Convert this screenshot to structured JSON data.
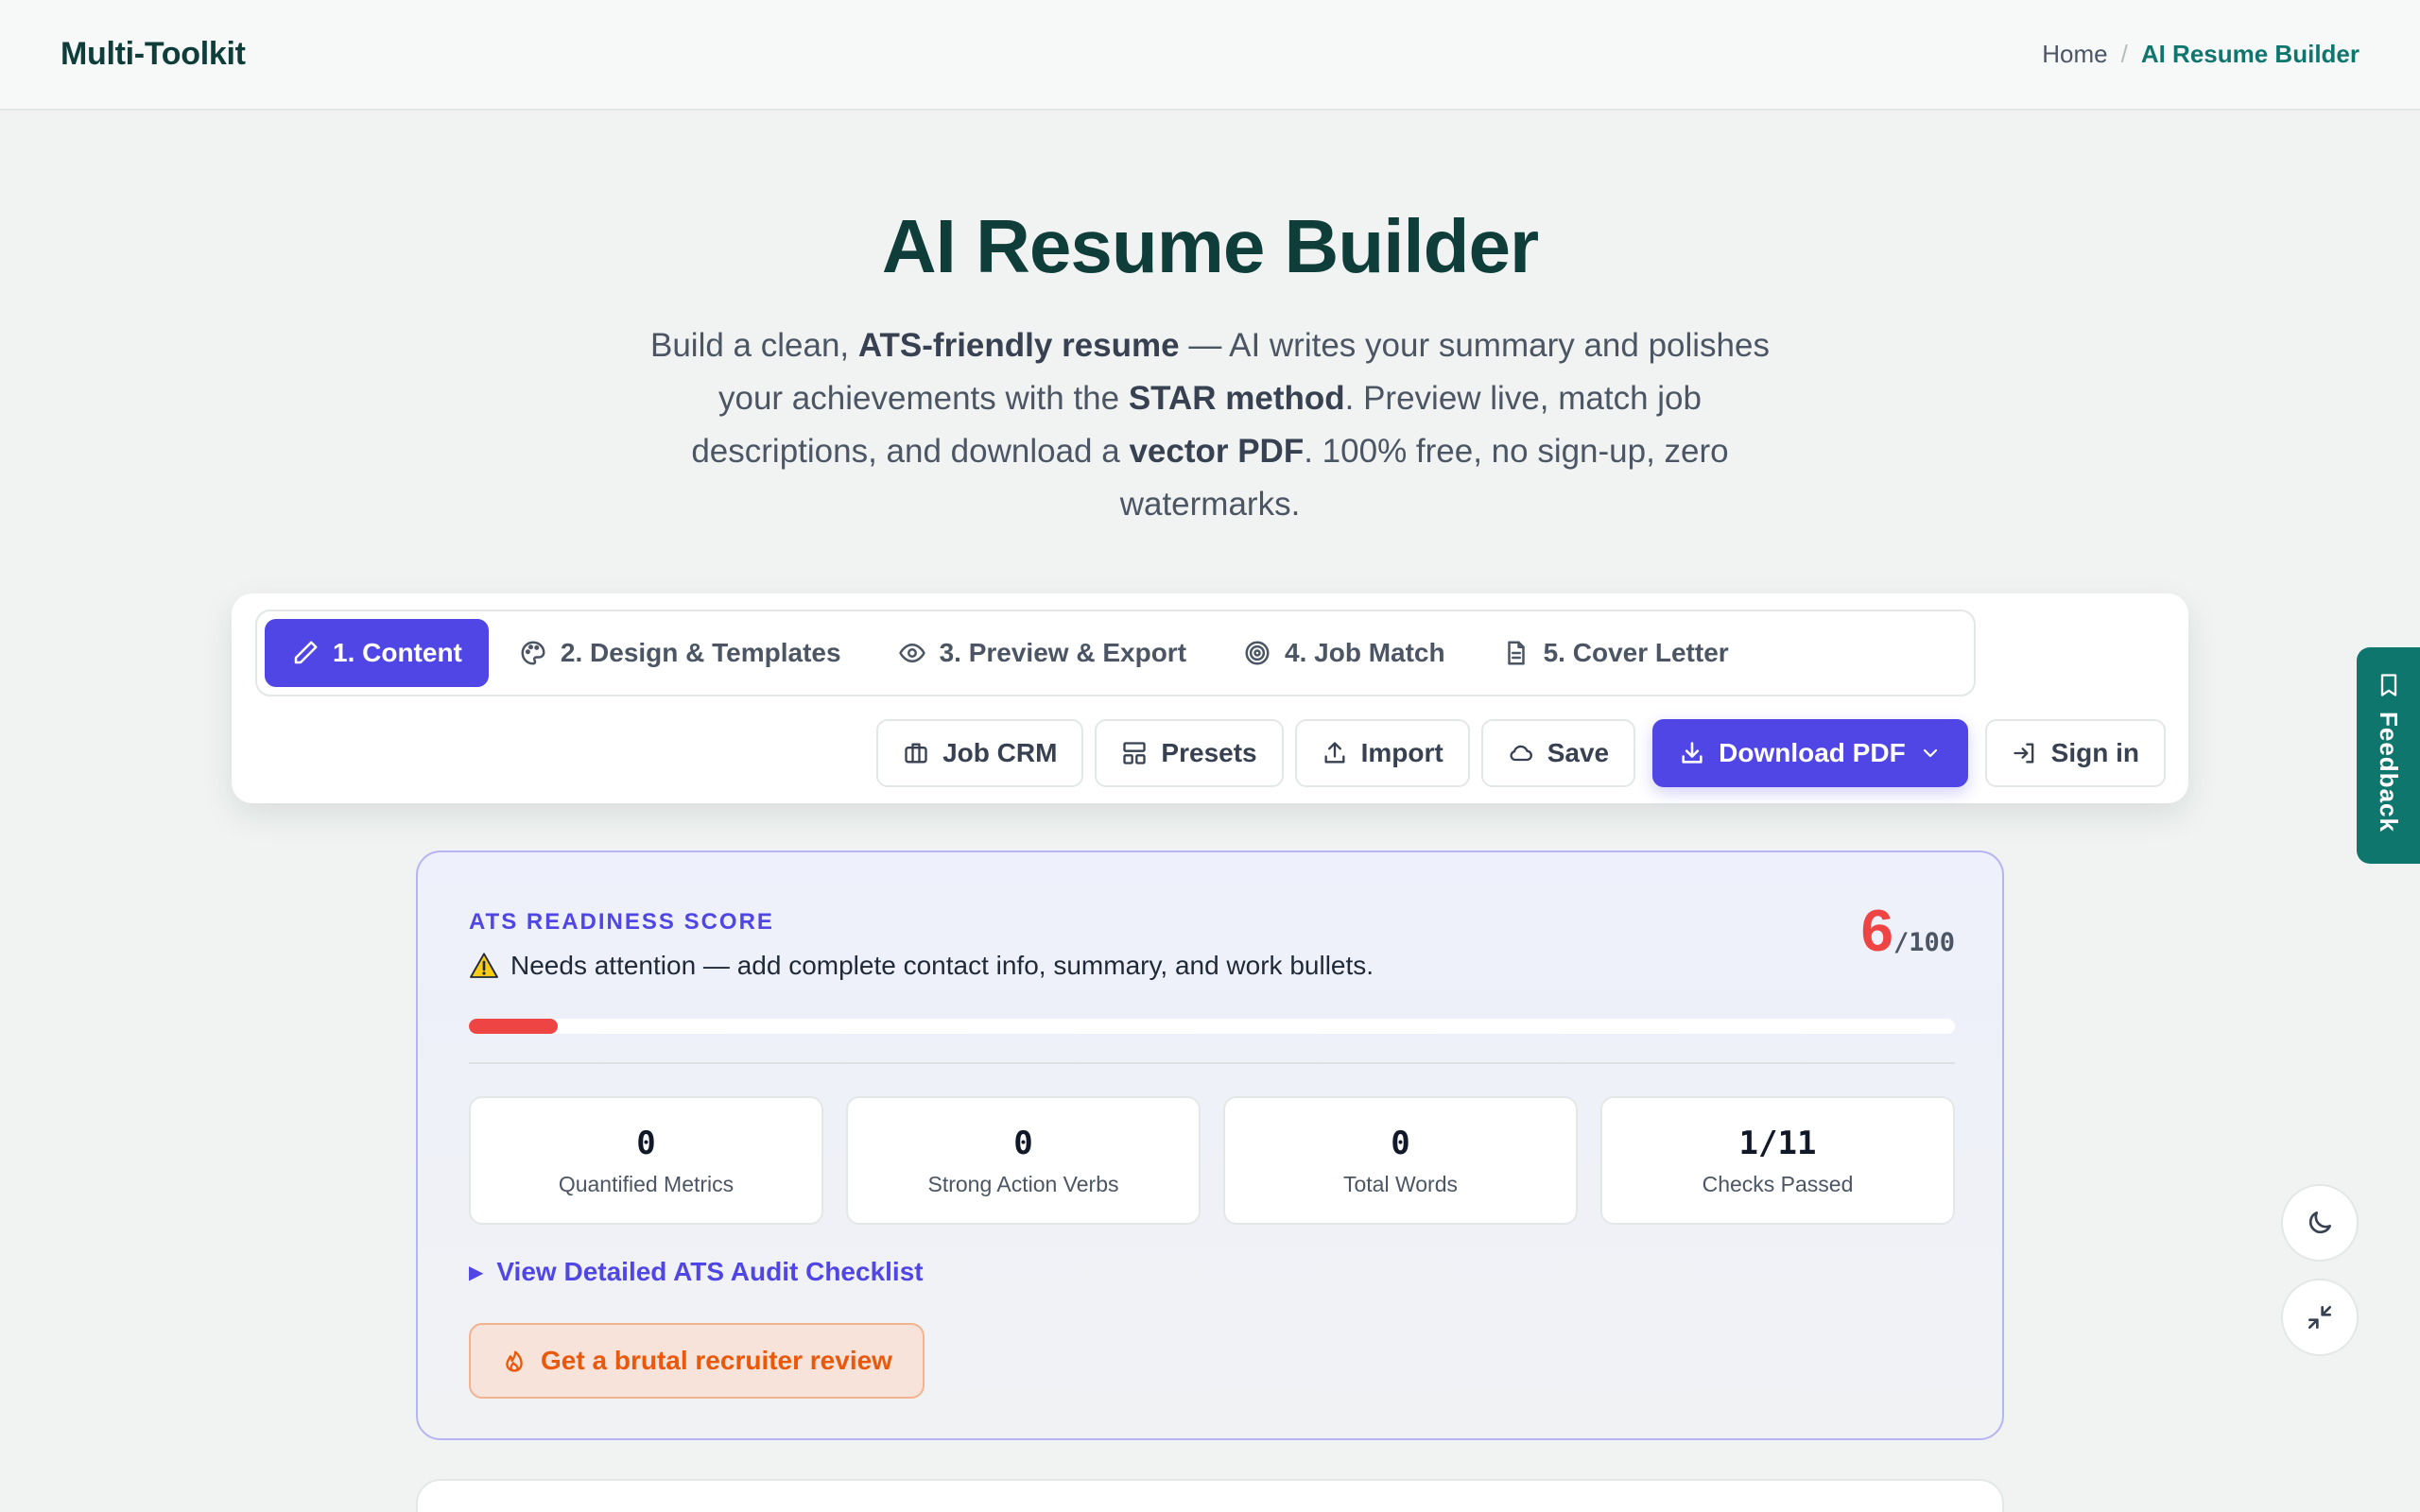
{
  "header": {
    "brand": "Multi-Toolkit",
    "breadcrumb": {
      "home": "Home",
      "separator": "/",
      "current": "AI Resume Builder"
    }
  },
  "hero": {
    "title": "AI Resume Builder",
    "subtitle": {
      "p1": "Build a clean, ",
      "b1": "ATS-friendly resume",
      "p2": " — AI writes your summary and polishes your achievements with the ",
      "b2": "STAR method",
      "p3": ". Preview live, match job descriptions, and download a ",
      "b3": "vector PDF",
      "p4": ". 100% free, no sign-up, zero watermarks."
    }
  },
  "tabs": [
    {
      "label": "1. Content",
      "icon": "pencil-icon",
      "active": true
    },
    {
      "label": "2. Design & Templates",
      "icon": "palette-icon",
      "active": false
    },
    {
      "label": "3. Preview & Export",
      "icon": "eye-icon",
      "active": false
    },
    {
      "label": "4. Job Match",
      "icon": "target-icon",
      "active": false
    },
    {
      "label": "5. Cover Letter",
      "icon": "document-icon",
      "active": false
    }
  ],
  "actions": {
    "job_crm": "Job CRM",
    "presets": "Presets",
    "import": "Import",
    "save": "Save",
    "download": "Download PDF",
    "sign_in": "Sign in"
  },
  "ats": {
    "label": "ATS READINESS SCORE",
    "message": "Needs attention — add complete contact info, summary, and work bullets.",
    "score": "6",
    "score_max": "/100",
    "progress_percent": 6,
    "stats": [
      {
        "value": "0",
        "label": "Quantified Metrics"
      },
      {
        "value": "0",
        "label": "Strong Action Verbs"
      },
      {
        "value": "0",
        "label": "Total Words"
      },
      {
        "value": "1/11",
        "label": "Checks Passed"
      }
    ],
    "audit_link": "View Detailed ATS Audit Checklist",
    "review_button": "Get a brutal recruiter review"
  },
  "feedback": {
    "label": "Feedback"
  },
  "colors": {
    "accent": "#4f46e5",
    "brand": "#0f3d3a",
    "teal": "#0f766e",
    "danger": "#ef4444",
    "warning_orange": "#ea580c"
  }
}
